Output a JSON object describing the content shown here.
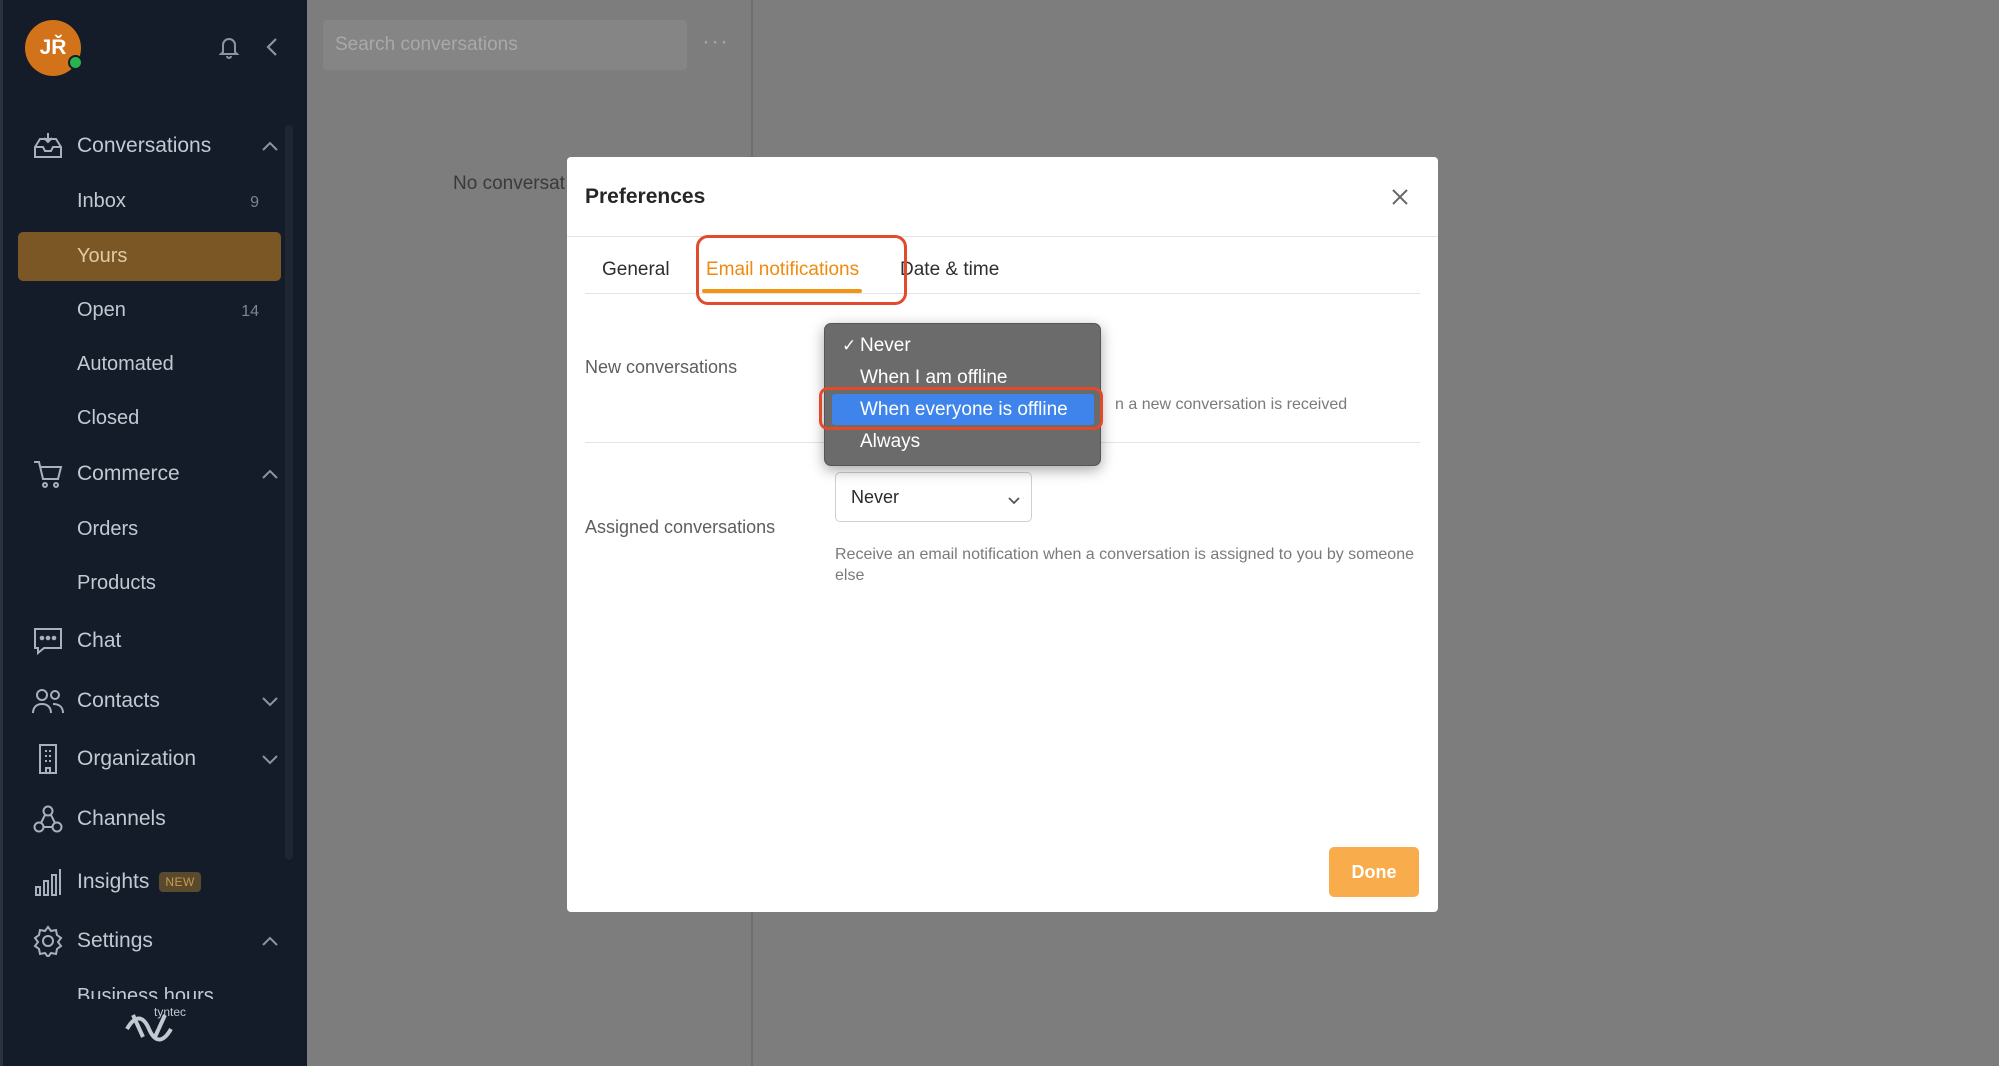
{
  "user": {
    "initials": "JŘ",
    "status_color": "#28b34b"
  },
  "sidebar": {
    "sections": {
      "conversations": "Conversations",
      "commerce": "Commerce",
      "chat": "Chat",
      "contacts": "Contacts",
      "organization": "Organization",
      "channels": "Channels",
      "insights": "Insights",
      "insights_badge": "NEW",
      "settings": "Settings"
    },
    "conversation_items": [
      {
        "label": "Inbox",
        "count": "9"
      },
      {
        "label": "Yours",
        "count": ""
      },
      {
        "label": "Open",
        "count": "14"
      },
      {
        "label": "Automated",
        "count": ""
      },
      {
        "label": "Closed",
        "count": ""
      }
    ],
    "commerce_items": [
      "Orders",
      "Products"
    ],
    "settings_items": [
      "Business hours"
    ],
    "logo_text": "tyntec"
  },
  "list": {
    "search_placeholder": "Search conversations",
    "empty_text": "No conversat"
  },
  "modal": {
    "title": "Preferences",
    "tabs": [
      "General",
      "Email notifications",
      "Date & time"
    ],
    "active_tab": "Email notifications",
    "rows": {
      "new_conversations": {
        "label": "New conversations",
        "help": "n a new conversation is received"
      },
      "assigned_conversations": {
        "label": "Assigned conversations",
        "selected": "Never",
        "help": "Receive an email notification when a conversation is assigned to you by someone else"
      }
    },
    "dropdown_options": [
      "Never",
      "When I am offline",
      "When everyone is offline",
      "Always"
    ],
    "dropdown_checked": "Never",
    "dropdown_highlighted": "When everyone is offline",
    "done_label": "Done"
  },
  "colors": {
    "accent": "#f39412",
    "sidebar_bg": "#131c28",
    "annotation": "#e24a2c",
    "selection": "#3e84ea"
  }
}
